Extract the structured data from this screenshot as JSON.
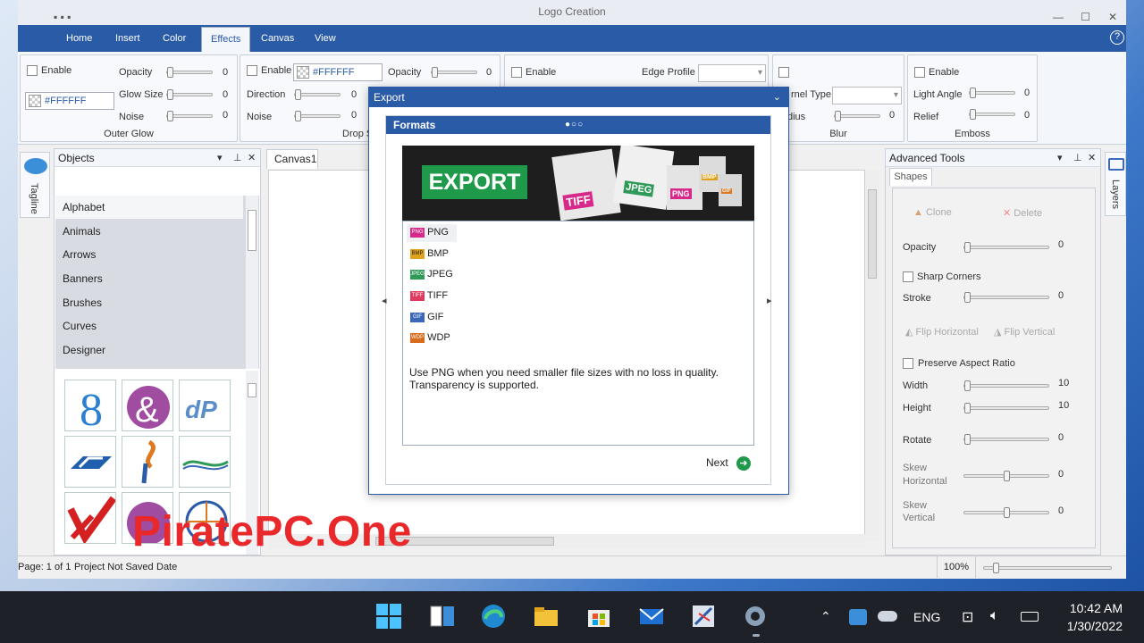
{
  "window": {
    "title": "Logo Creation"
  },
  "ribbon": {
    "tabs": [
      "Home",
      "Insert",
      "Color",
      "Effects",
      "Canvas",
      "View"
    ],
    "active_tab": "Effects",
    "help": "?",
    "outer_glow": {
      "enable": "Enable",
      "color": "#FFFFFF",
      "opacity": "Opacity",
      "opacity_val": "0",
      "glow_size": "Glow Size",
      "glow_val": "0",
      "noise": "Noise",
      "noise_val": "0",
      "title": "Outer Glow"
    },
    "drop_shadow": {
      "enable": "Enable",
      "color": "#FFFFFF",
      "opacity": "Opacity",
      "opacity_val": "0",
      "direction": "Direction",
      "direction_val": "0",
      "noise": "Noise",
      "noise_val": "0",
      "title": "Drop S"
    },
    "bevel": {
      "enable": "Enable",
      "edge_profile": "Edge Profile"
    },
    "blur": {
      "kernel_type": "rnel Type",
      "radius": "dius",
      "radius_val": "0",
      "title": "Blur"
    },
    "emboss": {
      "enable": "Enable",
      "light_angle": "Light Angle",
      "light_val": "0",
      "relief": "Relief",
      "relief_val": "0",
      "title": "Emboss"
    }
  },
  "objects_panel": {
    "title": "Objects",
    "items": [
      "Alphabet",
      "Animals",
      "Arrows",
      "Banners",
      "Brushes",
      "Curves",
      "Designer"
    ]
  },
  "left_tab": {
    "label": "Tagline"
  },
  "right_tab": {
    "label": "Layers"
  },
  "canvas_tab": {
    "label": "Canvas1"
  },
  "export_dialog": {
    "title": "Export",
    "section": "Formats",
    "banner_text": "EXPORT",
    "banner_files": [
      "TIFF",
      "JPEG",
      "PNG",
      "BMP",
      "GIF"
    ],
    "formats": [
      {
        "badge": "PNG",
        "label": "PNG",
        "color": "#d6298a"
      },
      {
        "badge": "BMP",
        "label": "BMP",
        "color": "#e0a21a"
      },
      {
        "badge": "JPEG",
        "label": "JPEG",
        "color": "#2f9a58"
      },
      {
        "badge": "TIFF",
        "label": "TIFF",
        "color": "#e03a5e"
      },
      {
        "badge": "GIF",
        "label": "GIF",
        "color": "#3a68b8"
      },
      {
        "badge": "WDP",
        "label": "WDP",
        "color": "#d96b1c"
      }
    ],
    "description_line1": "Use PNG when you need smaller file sizes with no loss in quality.",
    "description_line2": "Transparency is supported.",
    "next": "Next"
  },
  "advanced_tools": {
    "title": "Advanced Tools",
    "tab": "Shapes",
    "clone": "Clone",
    "delete": "Delete",
    "opacity": "Opacity",
    "opacity_val": "0",
    "sharp_corners": "Sharp Corners",
    "stroke": "Stroke",
    "stroke_val": "0",
    "flip_h": "Flip Horizontal",
    "flip_v": "Flip Vertical",
    "preserve": "Preserve Aspect Ratio",
    "width": "Width",
    "width_val": "10",
    "height": "Height",
    "height_val": "10",
    "rotate": "Rotate",
    "rotate_val": "0",
    "skew_h1": "Skew",
    "skew_h2": "Horizontal",
    "skew_h_val": "0",
    "skew_v1": "Skew",
    "skew_v2": "Vertical",
    "skew_v_val": "0"
  },
  "status": {
    "page": "Page: 1 of 1",
    "saved": "Project Not Saved",
    "date": "Date",
    "zoom": "100%"
  },
  "watermark": "PiratePC.One",
  "taskbar": {
    "lang": "ENG",
    "time": "10:42 AM",
    "date": "1/30/2022"
  }
}
